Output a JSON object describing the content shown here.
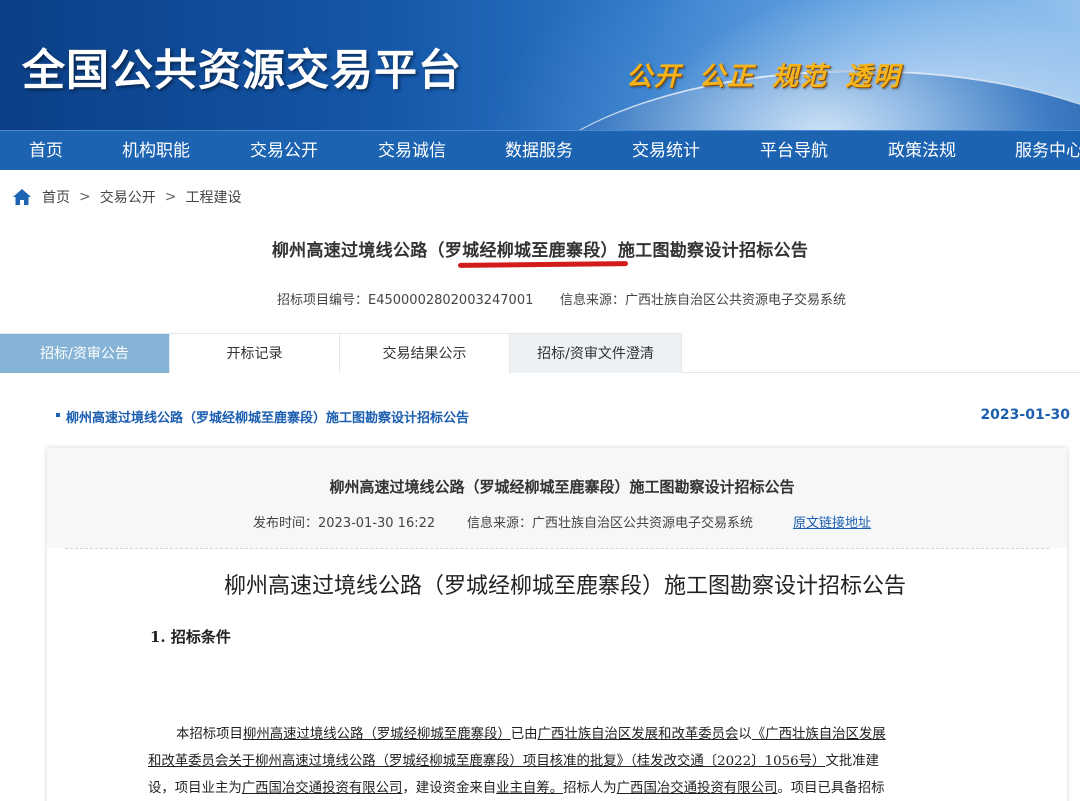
{
  "banner": {
    "site_title": "全国公共资源交易平台",
    "slogan": "公开 公正 规范 透明"
  },
  "nav": [
    "首页",
    "机构职能",
    "交易公开",
    "交易诚信",
    "数据服务",
    "交易统计",
    "平台导航",
    "政策法规",
    "服务中心"
  ],
  "breadcrumb": {
    "home": "首页",
    "level1": "交易公开",
    "level2": "工程建设",
    "separator": ">"
  },
  "page": {
    "title": "柳州高速过境线公路（罗城经柳城至鹿寨段）施工图勘察设计招标公告",
    "project_no": "招标项目编号：E4500002802003247001",
    "source": "信息来源：广西壮族自治区公共资源电子交易系统"
  },
  "tabs": [
    "招标/资审公告",
    "开标记录",
    "交易结果公示",
    "招标/资审文件澄清"
  ],
  "list_item": {
    "title": "柳州高速过境线公路（罗城经柳城至鹿寨段）施工图勘察设计招标公告",
    "date": "2023-01-30"
  },
  "card": {
    "title": "柳州高速过境线公路（罗城经柳城至鹿寨段）施工图勘察设计招标公告",
    "publish_time": "发布时间：2023-01-30 16:22",
    "source": "信息来源：广西壮族自治区公共资源电子交易系统",
    "link": "原文链接地址"
  },
  "document": {
    "title": "柳州高速过境线公路（罗城经柳城至鹿寨段）施工图勘察设计招标公告",
    "section1": "1. 招标条件",
    "p1_a": "本招标项目",
    "p1_b": "柳州高速过境线公路（罗城经柳城至鹿寨段）",
    "p1_c": "已由",
    "p1_d": "广西壮族自治区发展和改革委员会",
    "p1_e": "以",
    "p1_f": "《广西壮族自治区发展",
    "p2_a": "和改革委员会关于柳州高速过境线公路（罗城经柳城至鹿寨段）项目核准的批复》",
    "p2_b": "（桂发改交通〔2022〕1056号）",
    "p2_c": "文批准建",
    "p3_a": "设，项目业主为",
    "p3_b": "广西国冶交通投资有限公司",
    "p3_c": "，建设资金来自",
    "p3_d": "业主自筹。",
    "p3_e": "招标人为",
    "p3_f": "广西国冶交通投资有限公司",
    "p3_g": "。项目已具备招标"
  }
}
